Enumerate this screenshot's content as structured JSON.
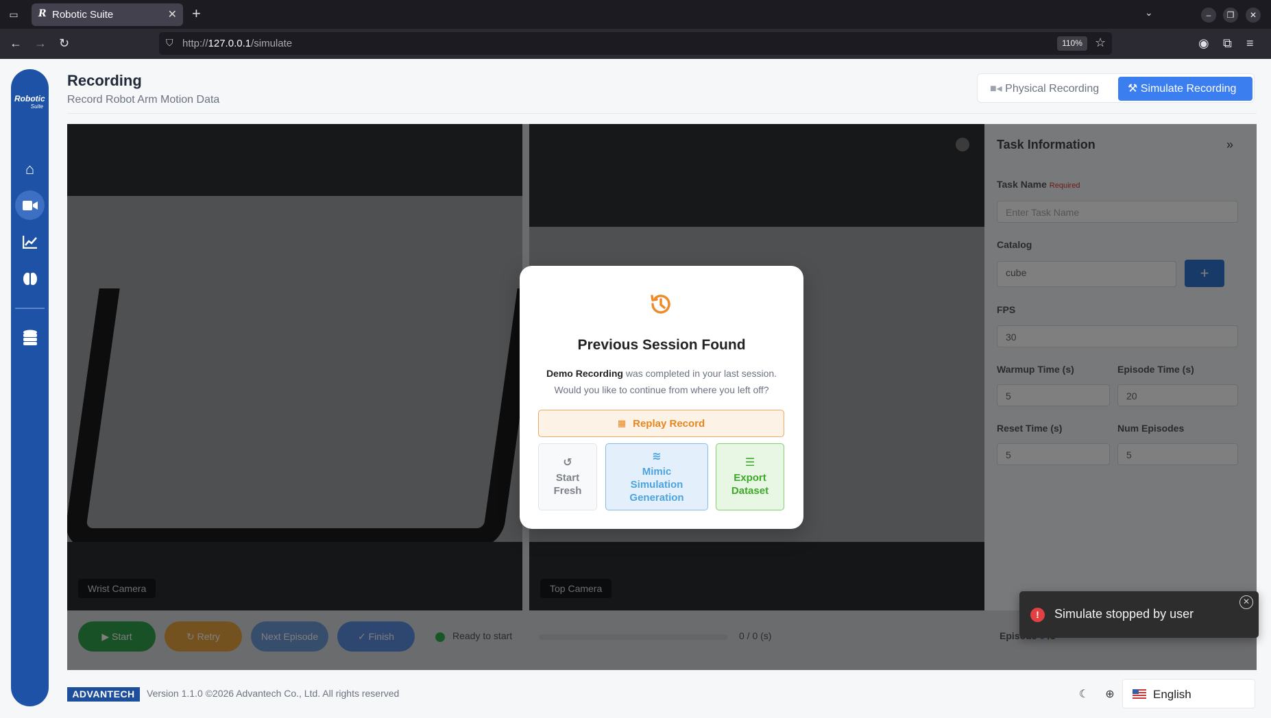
{
  "browser": {
    "tab_title": "Robotic Suite",
    "tab_favicon": "R",
    "url_prefix": "http://",
    "url_host": "127.0.0.1",
    "url_path": "/simulate",
    "zoom": "110%"
  },
  "sidebar": {
    "logo_main": "Robotic",
    "logo_sub": "Suite",
    "items": [
      {
        "name": "home-icon"
      },
      {
        "name": "video-icon",
        "active": true
      },
      {
        "name": "chart-icon"
      },
      {
        "name": "brain-icon"
      },
      {
        "name": "database-icon"
      }
    ]
  },
  "header": {
    "title": "Recording",
    "subtitle": "Record Robot Arm Motion Data",
    "mode_physical": "Physical Recording",
    "mode_simulate": "Simulate Recording"
  },
  "cameras": {
    "wrist_label": "Wrist Camera",
    "top_label": "Top Camera"
  },
  "task_panel": {
    "title": "Task Information",
    "task_name_label": "Task Name",
    "required": "Required",
    "task_name_placeholder": "Enter Task Name",
    "catalog_label": "Catalog",
    "catalog_value": "cube",
    "fps_label": "FPS",
    "fps_value": "30",
    "warmup_label": "Warmup Time (s)",
    "warmup_value": "5",
    "episode_time_label": "Episode Time (s)",
    "episode_time_value": "20",
    "reset_label": "Reset Time (s)",
    "reset_value": "5",
    "num_episodes_label": "Num Episodes",
    "num_episodes_value": "5"
  },
  "controls": {
    "start": "Start",
    "retry": "Retry",
    "next": "Next Episode",
    "finish": "Finish",
    "status": "Ready to start",
    "progress": "0 / 0 (s)",
    "progress_fraction": 0,
    "episode_prefix": "Episode",
    "episode_current": "0",
    "episode_total": "/5"
  },
  "modal": {
    "title": "Previous Session Found",
    "session_name": "Demo Recording",
    "desc_rest": " was completed in your last session.",
    "desc_line2": "Would you like to continue from where you left off?",
    "replay": "Replay Record",
    "start_fresh_1": "Start",
    "start_fresh_2": "Fresh",
    "mimic_1": "Mimic",
    "mimic_2": "Simulation",
    "mimic_3": "Generation",
    "export_1": "Export",
    "export_2": "Dataset",
    "accent_orange": "#e8851f",
    "accent_blue": "#4da3de",
    "accent_green": "#3da82a"
  },
  "toast": {
    "message": "Simulate stopped by user",
    "color": "#e34141"
  },
  "footer": {
    "brand": "ADVANTECH",
    "version": "Version 1.1.0 ©2026 Advantech Co., Ltd. All rights reserved",
    "language": "English"
  }
}
